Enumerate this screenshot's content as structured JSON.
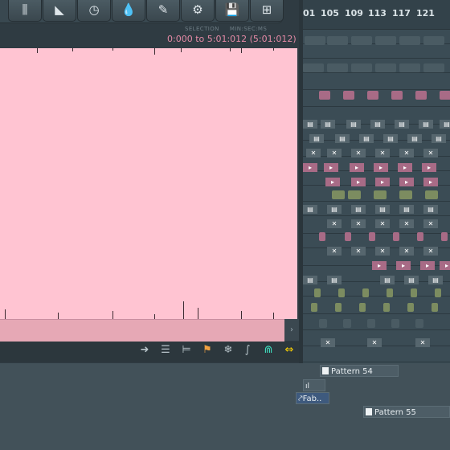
{
  "toolbar": {
    "buttons": [
      {
        "name": "spectrum-icon",
        "glyph": "⫼"
      },
      {
        "name": "envelope-icon",
        "glyph": "◣"
      },
      {
        "name": "clock-icon",
        "glyph": "◷"
      },
      {
        "name": "drop-icon",
        "glyph": "💧"
      },
      {
        "name": "feather-icon",
        "glyph": "✎"
      },
      {
        "name": "tuner-icon",
        "glyph": "⚙"
      },
      {
        "name": "save-icon",
        "glyph": "💾"
      },
      {
        "name": "grid-arrows-icon",
        "glyph": "⊞"
      }
    ]
  },
  "selection": {
    "label_selection": "SELECTION",
    "label_units": "MIN:SEC:MS",
    "range": "0:000 to 5:01:012 (5:01:012)"
  },
  "bottombar": {
    "icons": [
      {
        "name": "arrow-right-icon",
        "glyph": "➜"
      },
      {
        "name": "align-icon",
        "glyph": "☰"
      },
      {
        "name": "indent-icon",
        "glyph": "⊨"
      },
      {
        "name": "flag-icon",
        "glyph": "⚑"
      },
      {
        "name": "snowflake-icon",
        "glyph": "❄"
      },
      {
        "name": "curve-icon",
        "glyph": "∫"
      },
      {
        "name": "magnet-icon",
        "glyph": "⋒"
      },
      {
        "name": "resize-arrows-icon",
        "glyph": "⇔"
      }
    ],
    "scroll_arrow": "›"
  },
  "ruler": {
    "bars": [
      "01",
      "105",
      "109",
      "113",
      "117",
      "121"
    ]
  },
  "playlist": {
    "pattern54": "Pattern 54",
    "fab": "Fab..",
    "pattern55": "Pattern 55"
  },
  "colors": {
    "wave_background": "#ffc4d2",
    "selection_text": "#e58aa6",
    "accent_yellow": "#ffd400",
    "accent_cyan": "#3fe0c0"
  }
}
